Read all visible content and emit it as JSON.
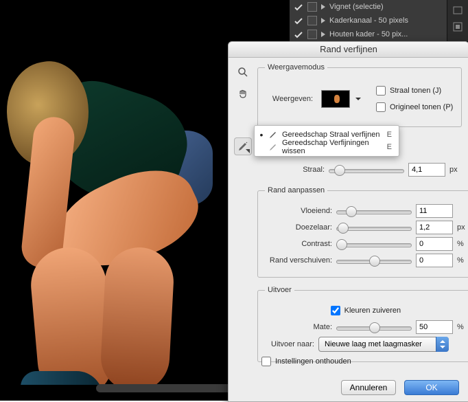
{
  "layers": [
    {
      "label": "Vignet (selectie)"
    },
    {
      "label": "Kaderkanaal - 50 pixels"
    },
    {
      "label": "Houten kader - 50 pix..."
    }
  ],
  "dialog": {
    "title": "Rand verfijnen",
    "group_view": "Weergavemodus",
    "view_label": "Weergeven:",
    "show_radius": "Straal tonen (J)",
    "show_original": "Origineel tonen (P)",
    "tool_popup": {
      "refine": "Gereedschap Straal verfijnen",
      "erase": "Gereedschap Verfijningen wissen",
      "refine_sc": "E",
      "erase_sc": "E"
    },
    "radius_label": "Straal:",
    "radius_value": "4,1",
    "radius_unit": "px",
    "group_adjust": "Rand aanpassen",
    "smooth_label": "Vloeiend:",
    "smooth_value": "11",
    "feather_label": "Doezelaar:",
    "feather_value": "1,2",
    "feather_unit": "px",
    "contrast_label": "Contrast:",
    "contrast_value": "0",
    "contrast_unit": "%",
    "shift_label": "Rand verschuiven:",
    "shift_value": "0",
    "shift_unit": "%",
    "group_output": "Uitvoer",
    "decontaminate": "Kleuren zuiveren",
    "amount_label": "Mate:",
    "amount_value": "50",
    "amount_unit": "%",
    "outputto_label": "Uitvoer naar:",
    "outputto_value": "Nieuwe laag met laagmasker",
    "remember": "Instellingen onthouden",
    "cancel": "Annuleren",
    "ok": "OK"
  }
}
